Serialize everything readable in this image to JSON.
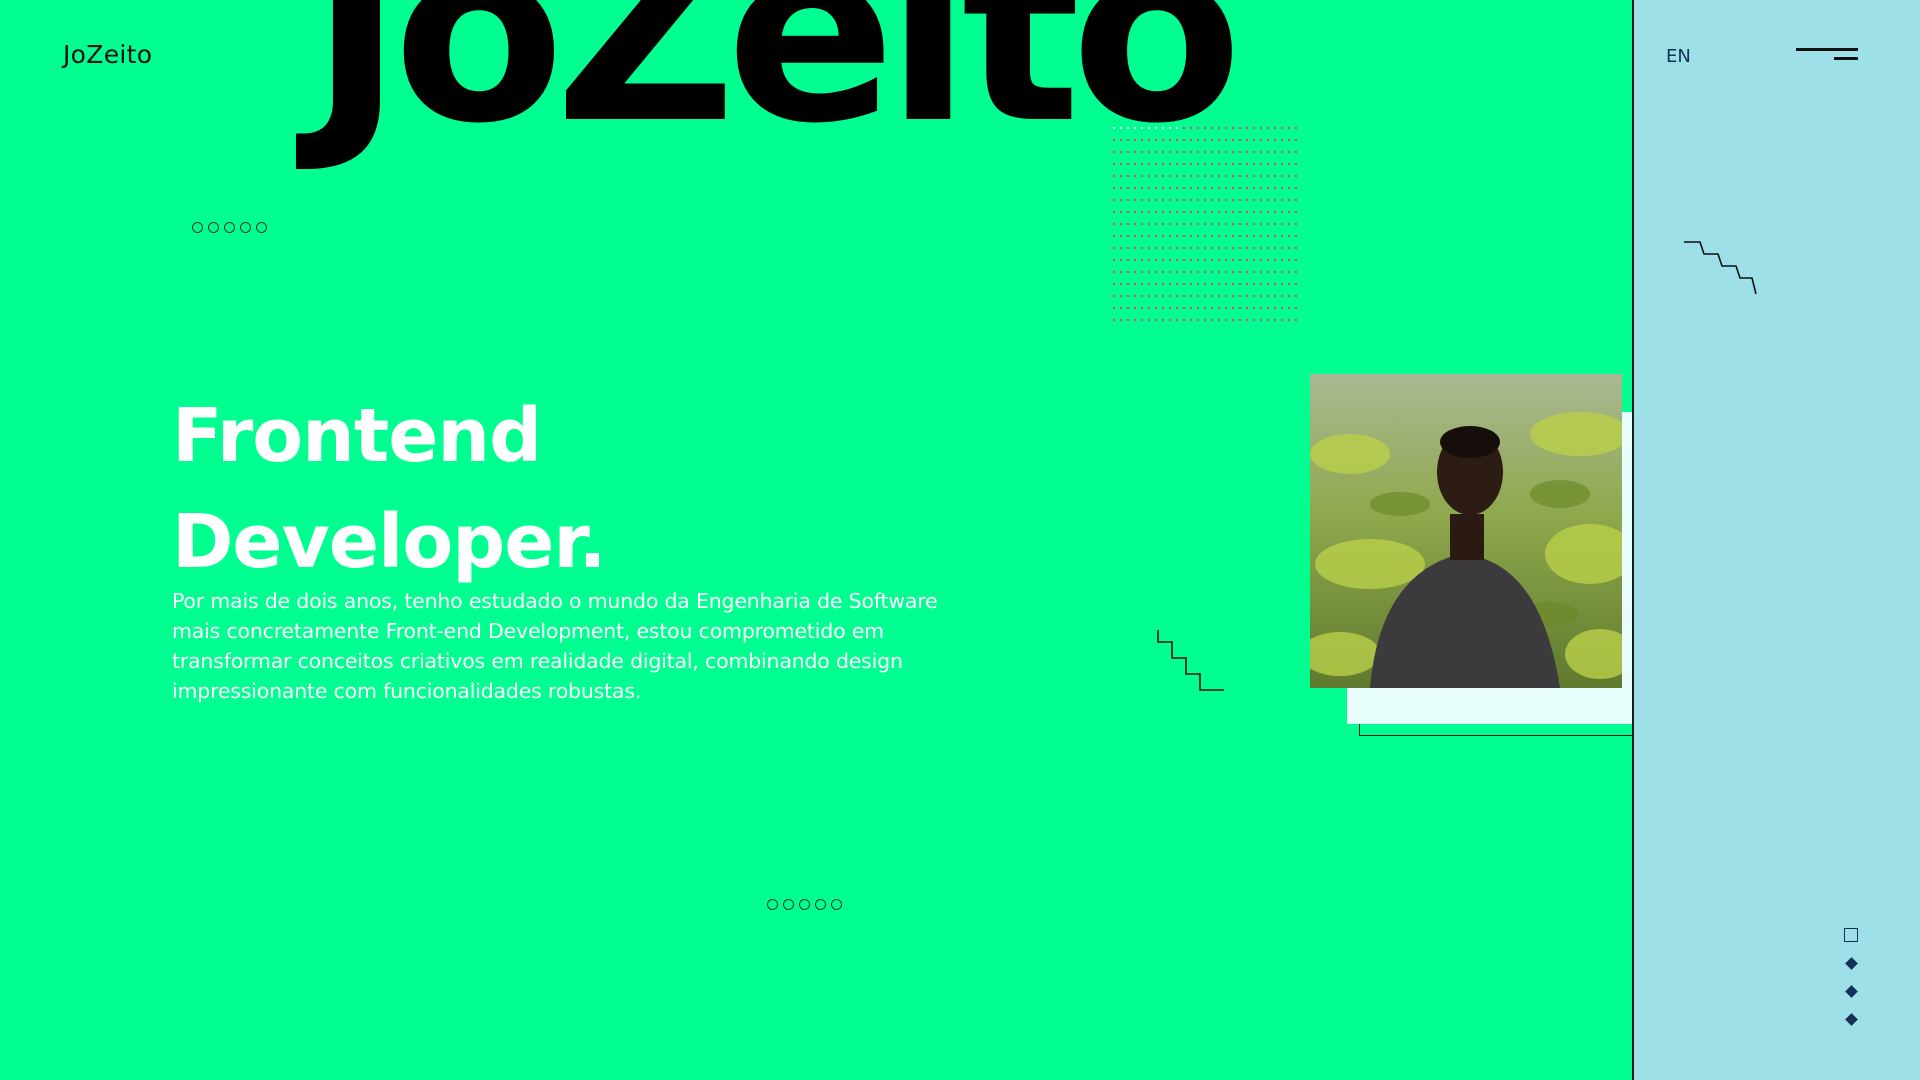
{
  "brand": {
    "name": "JoZeito"
  },
  "hero": {
    "big_title": "JoZeito",
    "title_line1": "Frontend",
    "title_line2": "Developer",
    "title_period": ".",
    "description": "Por mais de dois anos, tenho estudado o mundo da Engenharia de Software mais concretamente Front-end Development, estou comprometido em transformar conceitos criativos em realidade digital, combinando design impressionante com funcionalidades robustas."
  },
  "sidebar": {
    "language": "EN",
    "menu_icon": "hamburger-icon",
    "pager": [
      "square-icon",
      "diamond-icon",
      "diamond-icon",
      "diamond-icon"
    ]
  },
  "colors": {
    "main_bg": "#00ff90",
    "side_bg": "#9ee0e8",
    "photo_back": "#e6fdfb",
    "dot_grid": "#ff2a7a",
    "title": "#000000",
    "hero_text": "#ffffff"
  },
  "decor": {
    "circle_group_icon": "five-circles-icon",
    "zigzag_icon": "zigzag-stairs-icon",
    "dot_grid_icon": "dot-grid-pattern"
  }
}
